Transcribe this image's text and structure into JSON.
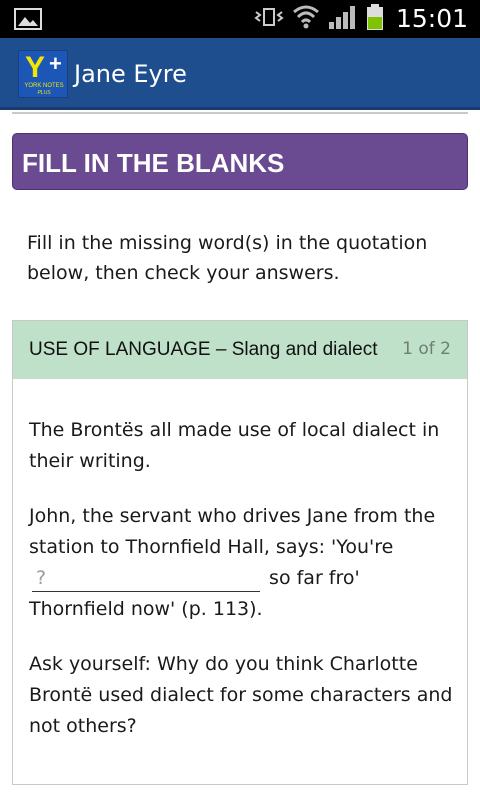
{
  "status_bar": {
    "time": "15:01",
    "icons": [
      "image-icon",
      "vibrate-icon",
      "wifi-icon",
      "signal-icon",
      "battery-icon"
    ],
    "battery_color": "#7ec200"
  },
  "app_bar": {
    "title": "Jane Eyre",
    "logo": {
      "mark": "Y",
      "plus": "+",
      "line1": "YORK NOTES",
      "line2": "PLUS"
    },
    "background": "#1f4e8f"
  },
  "section": {
    "header": "FILL IN THE BLANKS",
    "header_color": "#6a4b92"
  },
  "instruction": "Fill in the missing word(s) in the quotation below, then check your answers.",
  "card": {
    "title": "USE OF LANGUAGE – Slang and dialect",
    "count": "1 of 2",
    "header_color": "#bfe0c9",
    "paragraph1": "The Brontës all made use of local dialect in their writing.",
    "paragraph2_before": "John, the servant who drives Jane from the station to Thornfield Hall, says: 'You're",
    "blank_placeholder": "?",
    "paragraph2_after": "so far fro' Thornfield now' (p. 113).",
    "paragraph3": "Ask yourself: Why do you think Charlotte Brontë used dialect for some characters and not others?"
  }
}
